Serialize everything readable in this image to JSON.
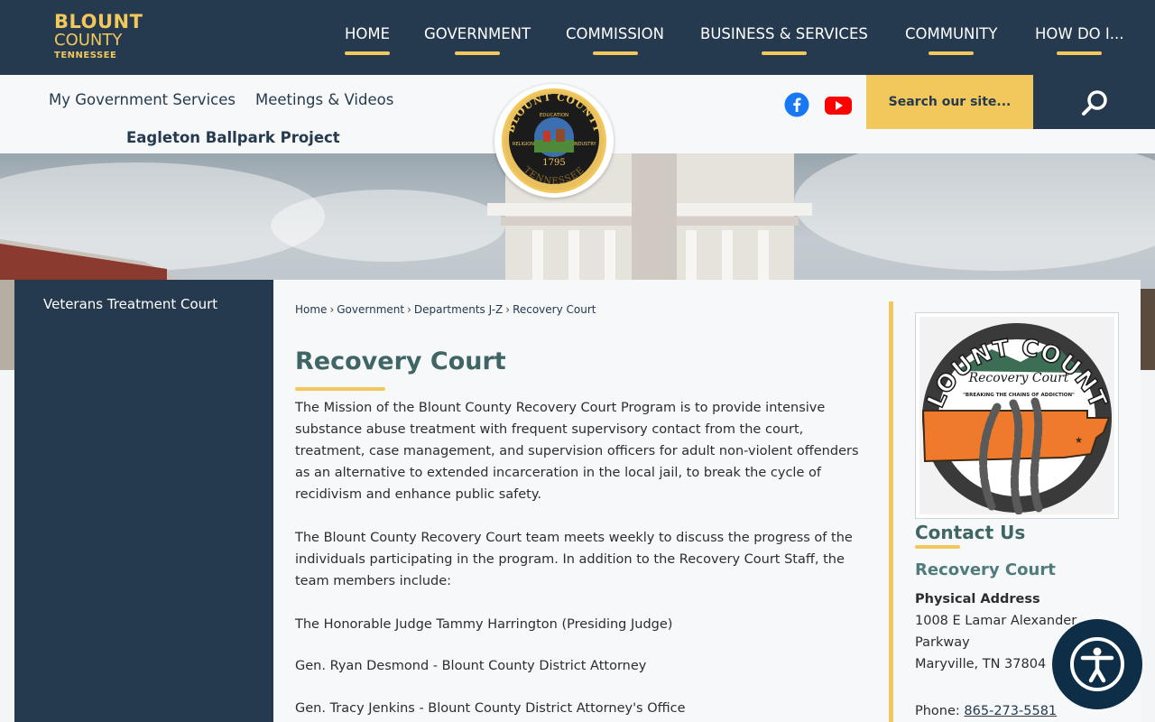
{
  "header": {
    "logo": {
      "line1": "BLOUNT",
      "line2": "COUNTY",
      "line3": "TENNESSEE"
    },
    "nav": [
      {
        "label": "HOME"
      },
      {
        "label": "GOVERNMENT"
      },
      {
        "label": "COMMISSION"
      },
      {
        "label": "BUSINESS & SERVICES"
      },
      {
        "label": "COMMUNITY"
      },
      {
        "label": "HOW DO I..."
      }
    ]
  },
  "subnav": {
    "items": [
      {
        "label": "My Government Services"
      },
      {
        "label": "Meetings & Videos"
      },
      {
        "label": "Eagleton Ballpark Project"
      }
    ],
    "social": [
      "facebook-icon",
      "youtube-icon"
    ],
    "search_placeholder": "Search our site...",
    "search_icon": "search-icon"
  },
  "seal": {
    "top_text": "BLOUNT COUNTY",
    "bottom_text": "TENNESSEE",
    "left_text": "RELIGION",
    "right_text": "INDUSTRY",
    "center_top": "EDUCATION",
    "year": "1795"
  },
  "sidebar": {
    "items": [
      {
        "label": "Veterans Treatment Court"
      }
    ]
  },
  "breadcrumb": {
    "items": [
      "Home",
      "Government",
      "Departments J-Z",
      "Recovery Court"
    ],
    "separator": "›"
  },
  "page": {
    "title": "Recovery Court",
    "paragraphs": [
      "The Mission of the Blount County Recovery Court Program is to provide intensive substance abuse treatment with frequent supervisory contact from the court, treatment, case management, and supervision officers for adult non-violent offenders as an alternative to extended incarceration in the local jail, to break the cycle of recidivism and enhance public safety.",
      "The Blount County Recovery Court team meets weekly to discuss the progress of the individuals participating in the program. In addition to the Recovery Court Staff, the team members include:",
      "The Honorable Judge Tammy Harrington (Presiding Judge)",
      "Gen. Ryan Desmond - Blount County District Attorney",
      "Gen. Tracy Jenkins - Blount County District Attorney's Office"
    ]
  },
  "contact": {
    "image_text": {
      "top": "BLOUNT COUNTY",
      "script": "Recovery Court",
      "tagline": "\"BREAKING THE CHAINS OF ADDICTION\""
    },
    "heading": "Contact Us",
    "department": "Recovery Court",
    "address_label": "Physical Address",
    "address_line1": "1008 E Lamar Alexander",
    "address_line2": "Parkway",
    "address_line3": "Maryville, TN 37804",
    "phone_label": "Phone:",
    "phone": "865-273-5581"
  },
  "accessibility": {
    "icon": "accessibility-icon"
  },
  "colors": {
    "navy": "#253a4e",
    "gold": "#f2c75c",
    "teal_heading": "#3f6564",
    "page_bg": "#f6f8fa"
  }
}
